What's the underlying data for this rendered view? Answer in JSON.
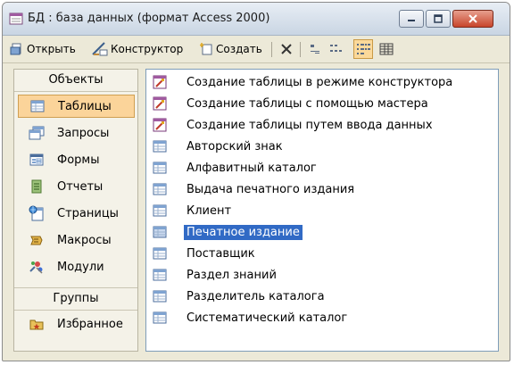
{
  "window": {
    "title": "БД : база данных (формат Access 2000)"
  },
  "toolbar": {
    "open_label": "Открыть",
    "design_label": "Конструктор",
    "create_label": "Создать"
  },
  "objects": {
    "header": "Объекты",
    "items": [
      {
        "label": "Таблицы",
        "icon": "table-icon",
        "selected": true
      },
      {
        "label": "Запросы",
        "icon": "query-icon"
      },
      {
        "label": "Формы",
        "icon": "form-icon"
      },
      {
        "label": "Отчеты",
        "icon": "report-icon"
      },
      {
        "label": "Страницы",
        "icon": "page-icon"
      },
      {
        "label": "Макросы",
        "icon": "macro-icon"
      },
      {
        "label": "Модули",
        "icon": "module-icon"
      }
    ],
    "groups_header": "Группы",
    "groups": [
      {
        "label": "Избранное",
        "icon": "favorites-icon"
      }
    ]
  },
  "list": {
    "items": [
      {
        "label": "Создание таблицы в режиме конструктора",
        "icon": "wizard-icon"
      },
      {
        "label": "Создание таблицы с помощью мастера",
        "icon": "wizard-icon"
      },
      {
        "label": "Создание таблицы путем ввода данных",
        "icon": "wizard-icon"
      },
      {
        "label": "Авторский знак",
        "icon": "table-icon"
      },
      {
        "label": "Алфавитный каталог",
        "icon": "table-icon"
      },
      {
        "label": "Выдача печатного издания",
        "icon": "table-icon"
      },
      {
        "label": "Клиент",
        "icon": "table-icon"
      },
      {
        "label": "Печатное издание",
        "icon": "table-icon",
        "selected": true
      },
      {
        "label": "Поставщик",
        "icon": "table-icon"
      },
      {
        "label": "Раздел знаний",
        "icon": "table-icon"
      },
      {
        "label": "Разделитель каталога",
        "icon": "table-icon"
      },
      {
        "label": "Систематический каталог",
        "icon": "table-icon"
      }
    ]
  },
  "colors": {
    "selection_blue": "#316ac5",
    "nav_selected": "#fbd49a",
    "window_bg": "#ece9d8"
  }
}
